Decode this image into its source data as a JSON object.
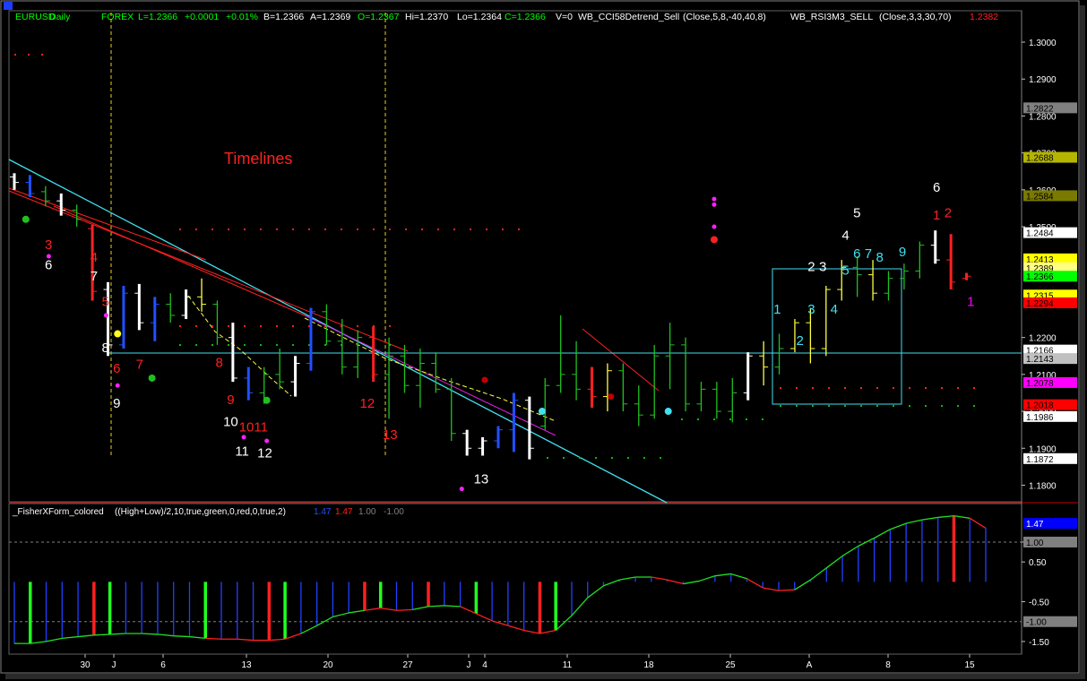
{
  "header": {
    "symbol": "EURUSD",
    "interval": "Daily",
    "market": "FOREX",
    "last": "L=1.2366",
    "change": "+0.0001",
    "change_pct": "+0.01%",
    "bid": "B=1.2366",
    "ask": "A=1.2369",
    "open": "O=1.2367",
    "high": "Hi=1.2370",
    "low": "Lo=1.2364",
    "close": "C=1.2366",
    "volume": "V=0",
    "study1": "WB_CCI58Detrend_Sell",
    "study1_params": "(Close,5,8,-40,40,8)",
    "study2": "WB_RSI3M3_SELL",
    "study2_params": "(Close,3,3,30,70)",
    "study2_value": "1.2382"
  },
  "annotation_text": "Timelines",
  "price_axis": {
    "ticks": [
      "1.3000",
      "1.2900",
      "1.2800",
      "1.2700",
      "1.2600",
      "1.2500",
      "1.2200",
      "1.2100",
      "1.2000",
      "1.1900",
      "1.1800"
    ],
    "tick_values": [
      1.3,
      1.29,
      1.28,
      1.27,
      1.26,
      1.25,
      1.22,
      1.21,
      1.2,
      1.19,
      1.18
    ],
    "ylim": [
      1.1755,
      1.3085
    ],
    "tags": [
      {
        "label": "1.2822",
        "value": 1.2822,
        "bg": "#808080",
        "fg": "#000000"
      },
      {
        "label": "1.2688",
        "value": 1.2688,
        "bg": "#b5b500",
        "fg": "#000000"
      },
      {
        "label": "1.2584",
        "value": 1.2584,
        "bg": "#7a7a00",
        "fg": "#000000"
      },
      {
        "label": "1.2484",
        "value": 1.2484,
        "bg": "#ffffff",
        "fg": "#000000"
      },
      {
        "label": "1.2413",
        "value": 1.2413,
        "bg": "#ffff00",
        "fg": "#000000"
      },
      {
        "label": "1.2389",
        "value": 1.2389,
        "bg": "#ffff80",
        "fg": "#000000"
      },
      {
        "label": "1.2366",
        "value": 1.2366,
        "bg": "#00ff00",
        "fg": "#000000"
      },
      {
        "label": "1.2315",
        "value": 1.2315,
        "bg": "#ffff00",
        "fg": "#000000"
      },
      {
        "label": "1.2294",
        "value": 1.2294,
        "bg": "#ff0000",
        "fg": "#000000"
      },
      {
        "label": "1.2166",
        "value": 1.2166,
        "bg": "#ffffff",
        "fg": "#000000"
      },
      {
        "label": "1.2143",
        "value": 1.2143,
        "bg": "#c0c0c0",
        "fg": "#000000"
      },
      {
        "label": "1.2078",
        "value": 1.2078,
        "bg": "#ff00ff",
        "fg": "#000000"
      },
      {
        "label": "1.2018",
        "value": 1.2018,
        "bg": "#ff0000",
        "fg": "#000000"
      },
      {
        "label": "1.1986",
        "value": 1.1986,
        "bg": "#ffffff",
        "fg": "#000000"
      },
      {
        "label": "1.1872",
        "value": 1.1872,
        "bg": "#ffffff",
        "fg": "#000000"
      }
    ]
  },
  "date_axis": {
    "labels": [
      "30",
      "J",
      "6",
      "13",
      "20",
      "27",
      "J",
      "4",
      "11",
      "18",
      "25",
      "A",
      "8",
      "15"
    ],
    "label_bar_index": [
      5,
      7,
      10,
      15,
      20,
      25,
      29,
      31,
      35,
      40,
      45,
      50,
      55,
      60
    ]
  },
  "fisher": {
    "title": "_FisherXForm_colored",
    "params": "((High+Low)/2,10,true,green,0,red,0,true,2)",
    "value1": "1.47",
    "value2": "1.47",
    "value3": "1.00",
    "value4": "-1.00",
    "ticks": [
      "1.00",
      "0.50",
      "-0.50",
      "-1.50"
    ],
    "tick_values": [
      1.0,
      0.5,
      -0.5,
      -1.5
    ],
    "tags": [
      {
        "label": "1.47",
        "value": 1.47,
        "bg": "#0000ff",
        "fg": "#ffffff"
      },
      {
        "label": "1.00",
        "value": 1.0,
        "bg": "#808080",
        "fg": "#000000"
      },
      {
        "label": "-1.00",
        "value": -1.0,
        "bg": "#808080",
        "fg": "#000000"
      }
    ],
    "ylim": [
      -1.75,
      1.9
    ],
    "values": [
      -1.55,
      -1.55,
      -1.5,
      -1.42,
      -1.38,
      -1.34,
      -1.32,
      -1.3,
      -1.3,
      -1.32,
      -1.36,
      -1.38,
      -1.42,
      -1.44,
      -1.44,
      -1.47,
      -1.47,
      -1.44,
      -1.3,
      -1.1,
      -0.88,
      -0.78,
      -0.72,
      -0.66,
      -0.72,
      -0.7,
      -0.62,
      -0.6,
      -0.62,
      -0.8,
      -0.98,
      -1.1,
      -1.22,
      -1.3,
      -1.22,
      -0.85,
      -0.4,
      -0.1,
      0.05,
      0.12,
      0.12,
      0.05,
      -0.05,
      0.02,
      0.15,
      0.2,
      0.08,
      -0.15,
      -0.22,
      -0.2,
      0.05,
      0.35,
      0.65,
      0.9,
      1.1,
      1.32,
      1.47,
      1.56,
      1.62,
      1.66,
      1.6,
      1.35
    ],
    "colors": [
      "g",
      "g",
      "g",
      "g",
      "g",
      "g",
      "g",
      "g",
      "g",
      "g",
      "g",
      "g",
      "r",
      "r",
      "r",
      "r",
      "r",
      "r",
      "g",
      "g",
      "g",
      "g",
      "r",
      "r",
      "r",
      "g",
      "g",
      "g",
      "r",
      "r",
      "r",
      "r",
      "r",
      "r",
      "g",
      "g",
      "g",
      "g",
      "g",
      "g",
      "r",
      "r",
      "g",
      "g",
      "g",
      "g",
      "r",
      "r",
      "r",
      "g",
      "g",
      "g",
      "g",
      "g",
      "g",
      "g",
      "g",
      "g",
      "g",
      "g",
      "r",
      "r"
    ],
    "spikes_green": [
      1,
      6,
      12,
      17,
      23,
      29,
      34
    ],
    "spikes_red": [
      5,
      16,
      22,
      26,
      33,
      59
    ]
  },
  "chart_data": {
    "type": "ohlc",
    "series_count": 62,
    "ohlc": [
      [
        1.2635,
        1.2645,
        1.26,
        1.262,
        "w"
      ],
      [
        1.262,
        1.264,
        1.258,
        1.259,
        "b"
      ],
      [
        1.2595,
        1.261,
        1.2555,
        1.257,
        "g"
      ],
      [
        1.257,
        1.259,
        1.253,
        1.2545,
        "w"
      ],
      [
        1.2545,
        1.256,
        1.25,
        1.252,
        "g"
      ],
      [
        1.2495,
        1.2505,
        1.23,
        1.2325,
        "r"
      ],
      [
        1.233,
        1.235,
        1.215,
        1.218,
        "w"
      ],
      [
        1.218,
        1.234,
        1.217,
        1.232,
        "b"
      ],
      [
        1.232,
        1.2345,
        1.222,
        1.224,
        "w"
      ],
      [
        1.224,
        1.231,
        1.219,
        1.229,
        "b"
      ],
      [
        1.229,
        1.232,
        1.224,
        1.226,
        "g"
      ],
      [
        1.226,
        1.233,
        1.225,
        1.231,
        "w"
      ],
      [
        1.231,
        1.236,
        1.227,
        1.229,
        "y"
      ],
      [
        1.229,
        1.23,
        1.218,
        1.22,
        "g"
      ],
      [
        1.22,
        1.224,
        1.208,
        1.209,
        "w"
      ],
      [
        1.209,
        1.212,
        1.203,
        1.205,
        "b"
      ],
      [
        1.205,
        1.212,
        1.202,
        1.21,
        "g"
      ],
      [
        1.21,
        1.217,
        1.206,
        1.208,
        "g"
      ],
      [
        1.208,
        1.215,
        1.204,
        1.213,
        "w"
      ],
      [
        1.213,
        1.228,
        1.211,
        1.227,
        "b"
      ],
      [
        1.227,
        1.229,
        1.218,
        1.219,
        "g"
      ],
      [
        1.219,
        1.225,
        1.21,
        1.212,
        "g"
      ],
      [
        1.212,
        1.222,
        1.209,
        1.22,
        "g"
      ],
      [
        1.22,
        1.223,
        1.208,
        1.21,
        "r"
      ],
      [
        1.21,
        1.22,
        1.198,
        1.215,
        "g"
      ],
      [
        1.215,
        1.218,
        1.205,
        1.207,
        "g"
      ],
      [
        1.207,
        1.217,
        1.201,
        1.213,
        "g"
      ],
      [
        1.213,
        1.216,
        1.205,
        1.206,
        "g"
      ],
      [
        1.206,
        1.209,
        1.192,
        1.194,
        "g"
      ],
      [
        1.194,
        1.195,
        1.188,
        1.19,
        "w"
      ],
      [
        1.19,
        1.193,
        1.188,
        1.192,
        "w"
      ],
      [
        1.192,
        1.196,
        1.19,
        1.195,
        "b"
      ],
      [
        1.195,
        1.205,
        1.189,
        1.203,
        "b"
      ],
      [
        1.203,
        1.204,
        1.187,
        1.19,
        "w"
      ],
      [
        1.196,
        1.209,
        1.195,
        1.207,
        "g"
      ],
      [
        1.207,
        1.226,
        1.205,
        1.21,
        "g"
      ],
      [
        1.21,
        1.219,
        1.203,
        1.206,
        "g"
      ],
      [
        1.206,
        1.212,
        1.201,
        1.204,
        "r"
      ],
      [
        1.204,
        1.213,
        1.2,
        1.211,
        "y"
      ],
      [
        1.211,
        1.213,
        1.2,
        1.202,
        "g"
      ],
      [
        1.202,
        1.207,
        1.196,
        1.199,
        "g"
      ],
      [
        1.199,
        1.218,
        1.198,
        1.215,
        "g"
      ],
      [
        1.215,
        1.224,
        1.206,
        1.218,
        "g"
      ],
      [
        1.218,
        1.22,
        1.2,
        1.202,
        "g"
      ],
      [
        1.202,
        1.208,
        1.2,
        1.206,
        "g"
      ],
      [
        1.206,
        1.208,
        1.198,
        1.2,
        "g"
      ],
      [
        1.2,
        1.209,
        1.197,
        1.205,
        "g"
      ],
      [
        1.205,
        1.216,
        1.203,
        1.215,
        "w"
      ],
      [
        1.215,
        1.219,
        1.207,
        1.212,
        "y"
      ],
      [
        1.212,
        1.221,
        1.21,
        1.217,
        "g"
      ],
      [
        1.217,
        1.225,
        1.216,
        1.224,
        "y"
      ],
      [
        1.224,
        1.228,
        1.213,
        1.217,
        "y"
      ],
      [
        1.217,
        1.234,
        1.215,
        1.233,
        "y"
      ],
      [
        1.233,
        1.241,
        1.23,
        1.239,
        "y"
      ],
      [
        1.239,
        1.242,
        1.231,
        1.237,
        "g"
      ],
      [
        1.237,
        1.241,
        1.23,
        1.232,
        "y"
      ],
      [
        1.232,
        1.238,
        1.23,
        1.236,
        "g"
      ],
      [
        1.236,
        1.24,
        1.233,
        1.238,
        "g"
      ],
      [
        1.238,
        1.246,
        1.236,
        1.245,
        "g"
      ],
      [
        1.245,
        1.249,
        1.24,
        1.241,
        "w"
      ],
      [
        1.241,
        1.248,
        1.233,
        1.235,
        "r"
      ],
      [
        1.236,
        1.2375,
        1.2355,
        1.2366,
        "r"
      ]
    ],
    "labels": [
      {
        "t": "3",
        "bar": 3,
        "price": 1.244,
        "c": "#ff2020"
      },
      {
        "t": "4",
        "bar": 7,
        "price": 1.2405,
        "c": "#ff2020"
      },
      {
        "t": "5",
        "bar": 8,
        "price": 1.2285,
        "c": "#ff2020"
      },
      {
        "t": "6",
        "bar": 3,
        "price": 1.2385,
        "c": "#ffffff"
      },
      {
        "t": "7",
        "bar": 7,
        "price": 1.2355,
        "c": "#ffffff"
      },
      {
        "t": "8",
        "bar": 8,
        "price": 1.216,
        "c": "#ffffff"
      },
      {
        "t": "6",
        "bar": 9,
        "price": 1.2105,
        "c": "#ff2020"
      },
      {
        "t": "7",
        "bar": 11,
        "price": 1.2115,
        "c": "#ff2020"
      },
      {
        "t": "8",
        "bar": 18,
        "price": 1.212,
        "c": "#ff2020"
      },
      {
        "t": "9",
        "bar": 9,
        "price": 1.201,
        "c": "#ffffff"
      },
      {
        "t": "9",
        "bar": 19,
        "price": 1.202,
        "c": "#ff2020"
      },
      {
        "t": "10",
        "bar": 19,
        "price": 1.196,
        "c": "#ffffff"
      },
      {
        "t": "1011",
        "bar": 21,
        "price": 1.1945,
        "c": "#ff2020"
      },
      {
        "t": "11",
        "bar": 20,
        "price": 1.188,
        "c": "#ffffff"
      },
      {
        "t": "12",
        "bar": 22,
        "price": 1.1875,
        "c": "#ffffff"
      },
      {
        "t": "12",
        "bar": 31,
        "price": 1.201,
        "c": "#ff2020"
      },
      {
        "t": "13",
        "bar": 33,
        "price": 1.1925,
        "c": "#ff2020"
      },
      {
        "t": "13",
        "bar": 41,
        "price": 1.1805,
        "c": "#ffffff"
      },
      {
        "t": "1",
        "bar": 67,
        "price": 1.2265,
        "c": "#40e0f0"
      },
      {
        "t": "2",
        "bar": 69,
        "price": 1.218,
        "c": "#40e0f0"
      },
      {
        "t": "3",
        "bar": 70,
        "price": 1.2265,
        "c": "#40e0f0"
      },
      {
        "t": "4",
        "bar": 72,
        "price": 1.2265,
        "c": "#40e0f0"
      },
      {
        "t": "2",
        "bar": 70,
        "price": 1.238,
        "c": "#ffffff"
      },
      {
        "t": "3",
        "bar": 71,
        "price": 1.238,
        "c": "#ffffff"
      },
      {
        "t": "5",
        "bar": 73,
        "price": 1.237,
        "c": "#40e0f0"
      },
      {
        "t": "4",
        "bar": 73,
        "price": 1.2465,
        "c": "#ffffff"
      },
      {
        "t": "5",
        "bar": 74,
        "price": 1.2525,
        "c": "#ffffff"
      },
      {
        "t": "6",
        "bar": 74,
        "price": 1.2415,
        "c": "#40e0f0"
      },
      {
        "t": "7",
        "bar": 75,
        "price": 1.2415,
        "c": "#40e0f0"
      },
      {
        "t": "8",
        "bar": 76,
        "price": 1.2405,
        "c": "#40e0f0"
      },
      {
        "t": "9",
        "bar": 78,
        "price": 1.242,
        "c": "#40e0f0"
      },
      {
        "t": "6",
        "bar": 81,
        "price": 1.2595,
        "c": "#ffffff"
      },
      {
        "t": "1",
        "bar": 81,
        "price": 1.252,
        "c": "#ff2020"
      },
      {
        "t": "2",
        "bar": 82,
        "price": 1.2525,
        "c": "#ff2020"
      },
      {
        "t": "1",
        "bar": 84,
        "price": 1.2285,
        "c": "#ff00ff"
      }
    ]
  }
}
